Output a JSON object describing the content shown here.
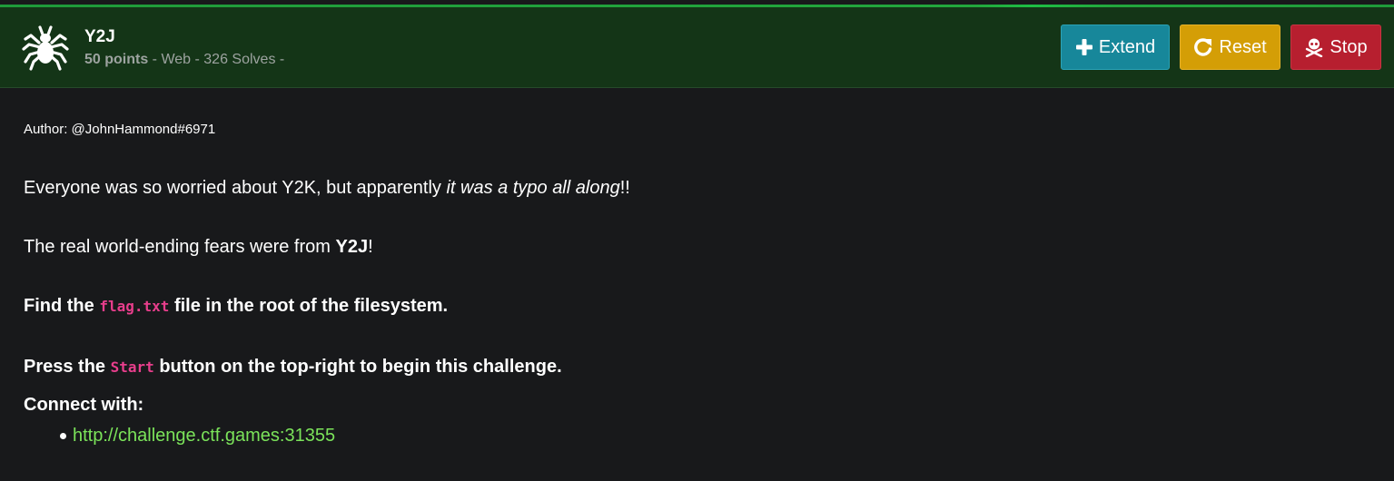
{
  "challenge": {
    "name": "Y2J",
    "points": "50 points",
    "meta_rest": " - Web - 326 Solves -",
    "icon": "spider-icon"
  },
  "buttons": {
    "extend": {
      "label": "Extend",
      "icon": "plus-icon",
      "color": "#17879a"
    },
    "reset": {
      "label": "Reset",
      "icon": "redo-icon",
      "color": "#d49e06"
    },
    "stop": {
      "label": "Stop",
      "icon": "skull-crossbones-icon",
      "color": "#b71f2f"
    }
  },
  "description": {
    "author": "Author: @JohnHammond#6971",
    "p1_start": "Everyone was so worried about Y2K, but apparently ",
    "p1_em": "it was a typo all along",
    "p1_end": "!!",
    "p2_start": "The real world-ending fears were from ",
    "p2_strong": "Y2J",
    "p2_end": "!",
    "p3_start": "Find the ",
    "p3_code": "flag.txt",
    "p3_end": " file in the root of the filesystem.",
    "p4_start": "Press the ",
    "p4_code": "Start",
    "p4_end": " button on the top-right to begin this challenge.",
    "connect_label": "Connect with:",
    "connect_url": "http://challenge.ctf.games:31355"
  },
  "colors": {
    "header_bg": "#143517",
    "page_bg": "#18191b",
    "accent_green": "#22a63d",
    "code_pink": "#e83e8c",
    "link_green": "#7be35a"
  }
}
